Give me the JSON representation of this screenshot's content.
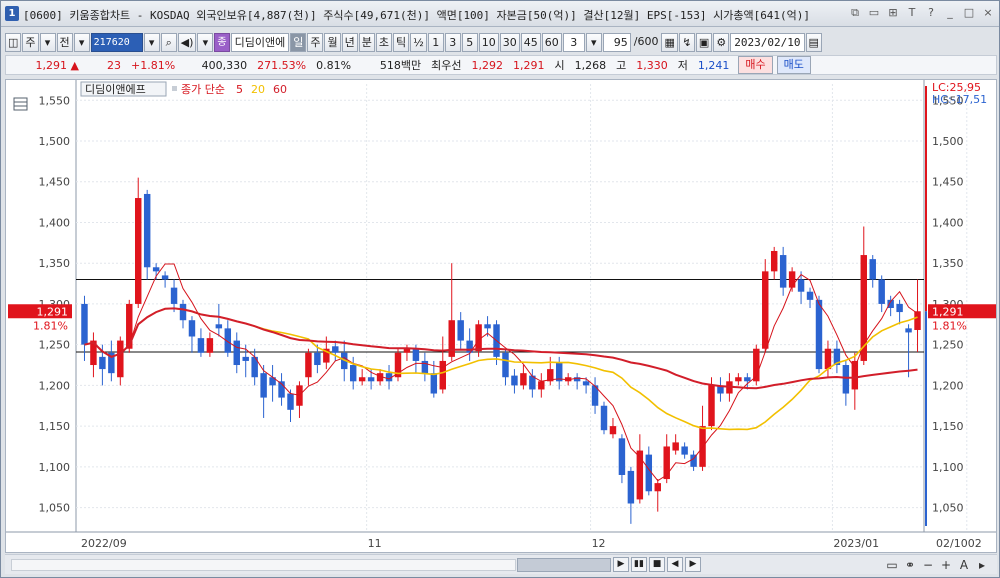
{
  "window": {
    "badge": "1",
    "title": "[0600] 키움종합차트 - KOSDAQ 외국인보유[4,887(천)] 주식수[49,671(천)] 액면[100] 자본금[50(억)] 결산[12월] EPS[-153] 시가총액[641(억)]",
    "controls": [
      "⧉",
      "▭",
      "⊞",
      "T",
      "?",
      "_",
      "□",
      "×"
    ]
  },
  "toolbar": {
    "period_week": "주",
    "period_all": "전",
    "code": "217620",
    "stock_name": "디딤이앤에",
    "stock_tag": "종",
    "intervals": [
      "일",
      "주",
      "월",
      "년",
      "분",
      "초",
      "틱"
    ],
    "active_interval": "일",
    "fraction": "½",
    "minute_steps": [
      "1",
      "3",
      "5",
      "10",
      "30",
      "45",
      "60"
    ],
    "step_value": "3",
    "count_value": "95",
    "count_total": "/600",
    "date": "2023/02/10"
  },
  "quote": {
    "price": "1,291",
    "arrow": "▲",
    "change": "23",
    "change_pct": "+1.81%",
    "volume": "400,330",
    "volume_ratio": "271.53%",
    "turnover": "0.81%",
    "amount": "518백만",
    "best_ask_label": "최우선",
    "best_ask": "1,292",
    "best_bid": "1,291",
    "open_label": "시",
    "open": "1,268",
    "high_label": "고",
    "high": "1,330",
    "low_label": "저",
    "low": "1,241",
    "buy_label": "매수",
    "sell_label": "매도"
  },
  "chart_legend": {
    "name": "디딤이앤에프",
    "ma_label": "종가 단순",
    "ma_periods": [
      "5",
      "20",
      "60"
    ]
  },
  "colors": {
    "up": "#e0141c",
    "down": "#2b63d0",
    "ma5": "#d6141c",
    "ma20": "#f2c000",
    "ma60": "#d21e2a"
  },
  "right_axis": {
    "lc": "LC:25,95",
    "hc": "HC:-17,51",
    "last_price": "1,291",
    "last_pct": "1.81%"
  },
  "left_axis": {
    "last_price": "1,291",
    "last_pct": "1.81%"
  },
  "date_axis": {
    "labels": [
      "2022/09",
      "11",
      "12",
      "2023/01",
      "02"
    ],
    "right_label": "02/10"
  },
  "chart_data": {
    "type": "candlestick",
    "y_ticks": [
      1050,
      1100,
      1150,
      1200,
      1250,
      1300,
      1350,
      1400,
      1450,
      1500,
      1550
    ],
    "ylim": [
      1020,
      1570
    ],
    "hlines": [
      1330,
      1241
    ],
    "candles": [
      [
        1300,
        1250,
        1310,
        1230
      ],
      [
        1225,
        1255,
        1265,
        1210
      ],
      [
        1235,
        1220,
        1250,
        1200
      ],
      [
        1240,
        1215,
        1255,
        1205
      ],
      [
        1210,
        1255,
        1260,
        1200
      ],
      [
        1245,
        1300,
        1305,
        1240
      ],
      [
        1300,
        1430,
        1455,
        1295
      ],
      [
        1435,
        1345,
        1440,
        1330
      ],
      [
        1345,
        1340,
        1350,
        1330
      ],
      [
        1335,
        1330,
        1340,
        1320
      ],
      [
        1320,
        1300,
        1330,
        1290
      ],
      [
        1300,
        1280,
        1305,
        1270
      ],
      [
        1280,
        1260,
        1285,
        1240
      ],
      [
        1258,
        1240,
        1270,
        1235
      ],
      [
        1240,
        1258,
        1265,
        1235
      ],
      [
        1275,
        1270,
        1300,
        1260
      ],
      [
        1270,
        1240,
        1280,
        1235
      ],
      [
        1255,
        1225,
        1265,
        1215
      ],
      [
        1235,
        1230,
        1250,
        1210
      ],
      [
        1235,
        1210,
        1245,
        1200
      ],
      [
        1215,
        1185,
        1225,
        1160
      ],
      [
        1210,
        1200,
        1225,
        1180
      ],
      [
        1205,
        1185,
        1215,
        1175
      ],
      [
        1190,
        1170,
        1195,
        1155
      ],
      [
        1175,
        1200,
        1205,
        1160
      ],
      [
        1210,
        1240,
        1245,
        1200
      ],
      [
        1240,
        1225,
        1250,
        1215
      ],
      [
        1228,
        1245,
        1260,
        1220
      ],
      [
        1248,
        1240,
        1255,
        1230
      ],
      [
        1240,
        1220,
        1255,
        1205
      ],
      [
        1225,
        1205,
        1235,
        1195
      ],
      [
        1205,
        1210,
        1220,
        1200
      ],
      [
        1210,
        1205,
        1220,
        1195
      ],
      [
        1205,
        1215,
        1220,
        1200
      ],
      [
        1215,
        1205,
        1225,
        1195
      ],
      [
        1210,
        1240,
        1245,
        1205
      ],
      [
        1240,
        1245,
        1250,
        1230
      ],
      [
        1245,
        1230,
        1250,
        1215
      ],
      [
        1230,
        1215,
        1240,
        1205
      ],
      [
        1215,
        1190,
        1230,
        1185
      ],
      [
        1195,
        1230,
        1260,
        1190
      ],
      [
        1235,
        1280,
        1350,
        1230
      ],
      [
        1280,
        1255,
        1290,
        1245
      ],
      [
        1255,
        1240,
        1270,
        1230
      ],
      [
        1242,
        1275,
        1280,
        1235
      ],
      [
        1275,
        1270,
        1285,
        1260
      ],
      [
        1275,
        1235,
        1280,
        1225
      ],
      [
        1240,
        1210,
        1245,
        1200
      ],
      [
        1212,
        1200,
        1220,
        1190
      ],
      [
        1200,
        1215,
        1225,
        1195
      ],
      [
        1212,
        1195,
        1220,
        1185
      ],
      [
        1195,
        1205,
        1215,
        1185
      ],
      [
        1205,
        1220,
        1235,
        1200
      ],
      [
        1228,
        1205,
        1235,
        1195
      ],
      [
        1205,
        1210,
        1215,
        1200
      ],
      [
        1210,
        1205,
        1215,
        1195
      ],
      [
        1205,
        1200,
        1210,
        1190
      ],
      [
        1200,
        1175,
        1210,
        1165
      ],
      [
        1175,
        1145,
        1180,
        1140
      ],
      [
        1140,
        1150,
        1160,
        1135
      ],
      [
        1135,
        1090,
        1140,
        1080
      ],
      [
        1095,
        1055,
        1100,
        1030
      ],
      [
        1060,
        1120,
        1140,
        1055
      ],
      [
        1115,
        1070,
        1125,
        1065
      ],
      [
        1070,
        1080,
        1085,
        1045
      ],
      [
        1085,
        1125,
        1140,
        1080
      ],
      [
        1120,
        1130,
        1140,
        1115
      ],
      [
        1125,
        1115,
        1130,
        1110
      ],
      [
        1115,
        1100,
        1120,
        1095
      ],
      [
        1100,
        1150,
        1175,
        1095
      ],
      [
        1150,
        1200,
        1210,
        1145
      ],
      [
        1200,
        1190,
        1210,
        1180
      ],
      [
        1190,
        1205,
        1215,
        1180
      ],
      [
        1205,
        1210,
        1215,
        1200
      ],
      [
        1210,
        1205,
        1215,
        1195
      ],
      [
        1205,
        1245,
        1250,
        1200
      ],
      [
        1245,
        1340,
        1355,
        1240
      ],
      [
        1340,
        1365,
        1370,
        1330
      ],
      [
        1360,
        1320,
        1370,
        1310
      ],
      [
        1320,
        1340,
        1345,
        1315
      ],
      [
        1330,
        1315,
        1340,
        1300
      ],
      [
        1315,
        1305,
        1320,
        1295
      ],
      [
        1305,
        1220,
        1310,
        1215
      ],
      [
        1220,
        1245,
        1255,
        1210
      ],
      [
        1245,
        1225,
        1255,
        1215
      ],
      [
        1225,
        1190,
        1230,
        1175
      ],
      [
        1195,
        1230,
        1240,
        1170
      ],
      [
        1230,
        1360,
        1395,
        1225
      ],
      [
        1355,
        1330,
        1360,
        1320
      ],
      [
        1330,
        1300,
        1335,
        1290
      ],
      [
        1305,
        1295,
        1310,
        1285
      ],
      [
        1300,
        1290,
        1305,
        1275
      ],
      [
        1270,
        1265,
        1275,
        1210
      ],
      [
        1268,
        1291,
        1330,
        1241
      ]
    ]
  }
}
